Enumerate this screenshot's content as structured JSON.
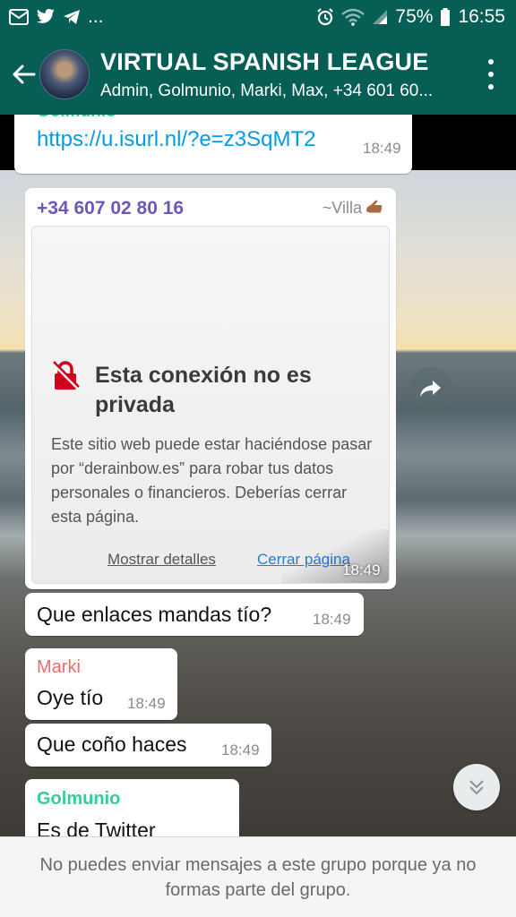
{
  "status_bar": {
    "battery": "75%",
    "clock": "16:55",
    "left_icons": [
      "mail-icon",
      "twitter-icon",
      "telegram-icon"
    ],
    "ellipsis": "...",
    "right_icons": [
      "alarm-icon",
      "wifi-icon",
      "signal-icon",
      "battery-icon"
    ]
  },
  "header": {
    "title": "VIRTUAL SPANISH LEAGUE",
    "members": "Admin, Golmunio, Marki, Max, +34 601 60..."
  },
  "messages": [
    {
      "sender": "Golmunio",
      "text": "https://u.isurl.nl/?e=z3SqMT2",
      "time": "18:49"
    },
    {
      "sender": "+34 607 02 80 16",
      "push_name": "~Villa",
      "time": "18:49",
      "image": {
        "title": "Esta conexión no es privada",
        "body": "Este sitio web puede estar haciéndose pasar por “derainbow.es” para robar tus datos personales o financieros. Deberías cerrar esta página.",
        "details_link": "Mostrar detalles",
        "close_link": "Cerrar página"
      }
    },
    {
      "text": "Que enlaces mandas tío?",
      "time": "18:49"
    },
    {
      "sender": "Marki",
      "text": "Oye tío",
      "time": "18:49"
    },
    {
      "text": "Que coño haces",
      "time": "18:49"
    },
    {
      "sender": "Golmunio",
      "text": "Es de Twitter"
    }
  ],
  "footer": {
    "notice": "No puedes enviar mensajes a este grupo porque ya no formas parte del grupo."
  },
  "colors": {
    "header_bg": "#075e54",
    "sender_golmunio": "#35cd96",
    "sender_phone": "#6e58b7",
    "sender_marki": "#ef6b6b",
    "link": "#039be5"
  }
}
